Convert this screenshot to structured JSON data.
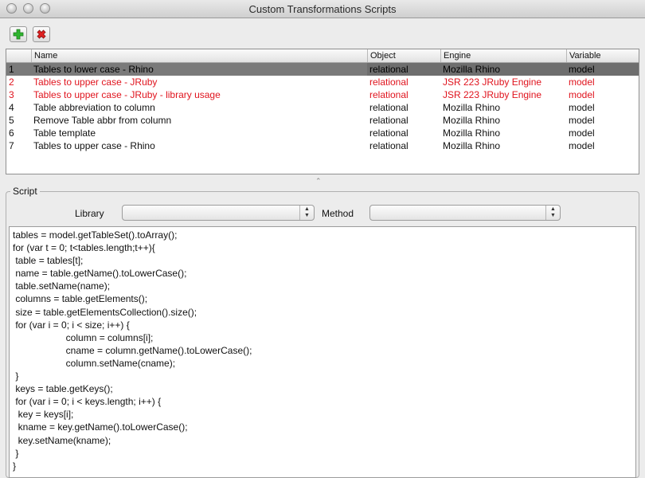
{
  "window": {
    "title": "Custom Transformations Scripts"
  },
  "toolbar": {
    "add_icon": "plus-icon",
    "delete_icon": "x-icon"
  },
  "table": {
    "columns": [
      "",
      "Name",
      "Object",
      "Engine",
      "Variable"
    ],
    "rows": [
      {
        "index": "1",
        "name": "Tables to lower case - Rhino",
        "object": "relational",
        "engine": "Mozilla Rhino",
        "variable": "model",
        "selected": true,
        "color": "#000000"
      },
      {
        "index": "2",
        "name": "Tables to upper case - JRuby",
        "object": "relational",
        "engine": "JSR 223 JRuby Engine",
        "variable": "model",
        "selected": false,
        "color": "#e0141e"
      },
      {
        "index": "3",
        "name": "Tables to upper case - JRuby - library usage",
        "object": "relational",
        "engine": "JSR 223 JRuby Engine",
        "variable": "model",
        "selected": false,
        "color": "#e0141e"
      },
      {
        "index": "4",
        "name": "Table abbreviation to column",
        "object": "relational",
        "engine": "Mozilla Rhino",
        "variable": "model",
        "selected": false,
        "color": "#000000"
      },
      {
        "index": "5",
        "name": "Remove Table abbr from column",
        "object": "relational",
        "engine": "Mozilla Rhino",
        "variable": "model",
        "selected": false,
        "color": "#000000"
      },
      {
        "index": "6",
        "name": "Table template",
        "object": "relational",
        "engine": "Mozilla Rhino",
        "variable": "model",
        "selected": false,
        "color": "#000000"
      },
      {
        "index": "7",
        "name": "Tables to upper case - Rhino",
        "object": "relational",
        "engine": "Mozilla Rhino",
        "variable": "model",
        "selected": false,
        "color": "#000000"
      }
    ]
  },
  "script": {
    "group_label": "Script",
    "library_label": "Library",
    "library_value": "",
    "method_label": "Method",
    "method_value": "",
    "code": "tables = model.getTableSet().toArray();\nfor (var t = 0; t<tables.length;t++){\n table = tables[t];\n name = table.getName().toLowerCase();\n table.setName(name);\n columns = table.getElements();\n size = table.getElementsCollection().size();\n for (var i = 0; i < size; i++) {\n                    column = columns[i];\n                    cname = column.getName().toLowerCase();\n                    column.setName(cname);\n }\n keys = table.getKeys();\n for (var i = 0; i < keys.length; i++) {\n  key = keys[i];\n  kname = key.getName().toLowerCase();\n  key.setName(kname);\n }\n}"
  }
}
